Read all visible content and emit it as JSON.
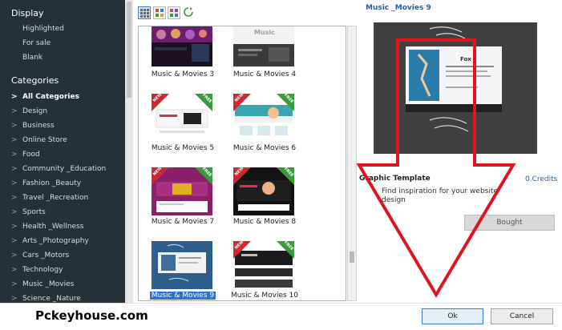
{
  "sidebar": {
    "display_heading": "Display",
    "display_items": [
      "Highlighted",
      "For sale",
      "Blank"
    ],
    "categories_heading": "Categories",
    "categories": [
      {
        "label": "All Categories",
        "active": true
      },
      {
        "label": "Design"
      },
      {
        "label": "Business"
      },
      {
        "label": "Online Store"
      },
      {
        "label": "Food"
      },
      {
        "label": "Community _Education"
      },
      {
        "label": "Fashion _Beauty"
      },
      {
        "label": "Travel _Recreation"
      },
      {
        "label": "Sports"
      },
      {
        "label": "Health _Wellness"
      },
      {
        "label": "Arts _Photography"
      },
      {
        "label": "Cars _Motors"
      },
      {
        "label": "Technology"
      },
      {
        "label": "Music _Movies"
      },
      {
        "label": "Science _Nature"
      }
    ]
  },
  "gallery": {
    "items": [
      {
        "label": "Music & Movies 3",
        "badges": false
      },
      {
        "label": "Music & Movies 4",
        "badges": false,
        "thumb_text": "Music"
      },
      {
        "label": "Music & Movies 5",
        "badges": true
      },
      {
        "label": "Music & Movies 6",
        "badges": true
      },
      {
        "label": "Music & Movies 7",
        "badges": true
      },
      {
        "label": "Music & Movies 8",
        "badges": true
      },
      {
        "label": "Music & Movies 9",
        "badges": false,
        "selected": true
      },
      {
        "label": "Music & Movies 10",
        "badges": true
      }
    ],
    "badge_new": "NEW",
    "badge_free": "FREE"
  },
  "preview": {
    "title": "Music _Movies 9",
    "inner_heading": "Fox",
    "template_type": "Graphic Template",
    "credits": "0 Credits",
    "description": "Find inspiration for your website design",
    "bought_label": "Bought"
  },
  "footer": {
    "watermark": "Pckeyhouse.com",
    "ok_label": "Ok",
    "cancel_label": "Cancel"
  },
  "colors": {
    "sidebar_bg": "#253139",
    "accent_blue": "#1e5fb4",
    "selection": "#2a73d9",
    "annotation_red": "#e0141e"
  }
}
